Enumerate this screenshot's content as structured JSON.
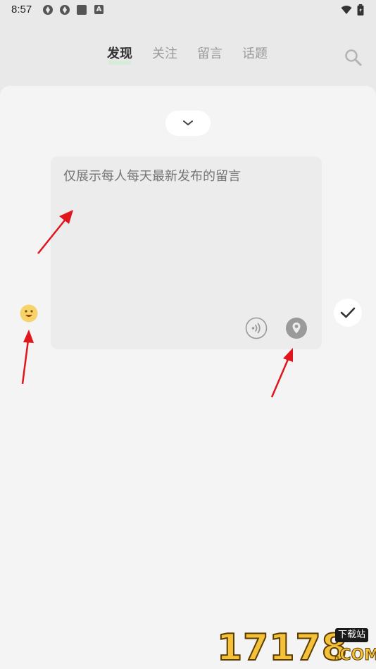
{
  "status_bar": {
    "time": "8:57",
    "icons": [
      "app-shutter-icon",
      "app-shutter-icon",
      "app-square-icon",
      "keyboard-a-icon",
      "wifi-icon",
      "battery-icon"
    ],
    "letter_icon": "A"
  },
  "nav": {
    "tabs": [
      {
        "label": "发现",
        "active": true
      },
      {
        "label": "关注",
        "active": false
      },
      {
        "label": "留言",
        "active": false
      },
      {
        "label": "话题",
        "active": false
      }
    ],
    "search_icon": "search-icon"
  },
  "composer": {
    "collapse_icon": "chevron-down-icon",
    "placeholder": "仅展示每人每天最新发布的留言",
    "voice_icon": "voice-icon",
    "location_icon": "location-icon",
    "emoji_icon": "emoji-icon",
    "submit_icon": "check-icon"
  },
  "watermark": {
    "digits": "17178",
    "badge": "下载站",
    "suffix": ".COM"
  },
  "colors": {
    "background": "#e9e9e9",
    "sheet": "#f4f4f4",
    "editor": "#ececec",
    "active_underline": "#d6ecd8",
    "arrow": "#e0161c",
    "emoji": "#f7d46a"
  }
}
